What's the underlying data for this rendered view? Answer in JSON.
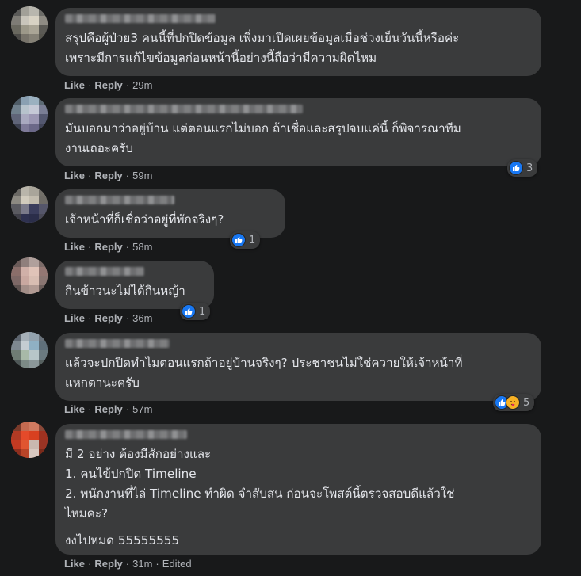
{
  "colors": {
    "background": "#18191a",
    "bubble": "#3a3b3c",
    "text": "#e4e6eb",
    "secondary": "#b0b3b8",
    "like_blue": "#1877f2",
    "care_yellow": "#f7b125"
  },
  "actions": {
    "like": "Like",
    "reply": "Reply",
    "separator": "·"
  },
  "comments": [
    {
      "text": "สรุปคือผู้ป่วย3 คนนี้ที่ปกปิดข้อมูล เพิ่งมาเปิดเผยข้อมูลเมื่อช่วงเย็นวันนี้หรือค่ะ\nเพราะมีการแก้ไขข้อมูลก่อนหน้านี้อย่างนี้ถือว่ามีความผิดไหม",
      "time": "29m",
      "reactions": null
    },
    {
      "text": "มันบอกมาว่าอยู่บ้าน แต่ตอนแรกไม่บอก ถ้าเชื่อและสรุปจบแค่นี้ ก็พิจารณาทีม\nงานเถอะครับ",
      "time": "59m",
      "reactions": {
        "icons": [
          "like-icon"
        ],
        "count": "3"
      }
    },
    {
      "text": "เจ้าหน้าที่ก็เชื่อว่าอยู่ที่พักจริงๆ?",
      "time": "58m",
      "reactions": {
        "icons": [
          "like-icon"
        ],
        "count": "1"
      }
    },
    {
      "text": "กินข้าวนะไม่ได้กินหญ้า",
      "time": "36m",
      "reactions": {
        "icons": [
          "like-icon"
        ],
        "count": "1"
      }
    },
    {
      "text": "แล้วจะปกปิดทำไมตอนแรกถ้าอยู่บ้านจริงๆ? ประชาชนไม่ใช่ควายให้เจ้าหน้าที่\nแหกตานะครับ",
      "time": "57m",
      "reactions": {
        "icons": [
          "like-icon",
          "care-icon"
        ],
        "count": "5"
      }
    },
    {
      "text": "มี 2 อย่าง ต้องมีสักอย่างและ\n1. คนไข้ปกปิด Timeline\n2. พนักงานที่ไล่ Timeline ทำผิด จำสับสน ก่อนจะโพสต์นี้ตรวจสอบดีแล้วใช่\nไหมคะ?",
      "text2": "งงไปหมด 55555555",
      "time": "31m",
      "edited": "Edited",
      "reactions": null
    }
  ]
}
